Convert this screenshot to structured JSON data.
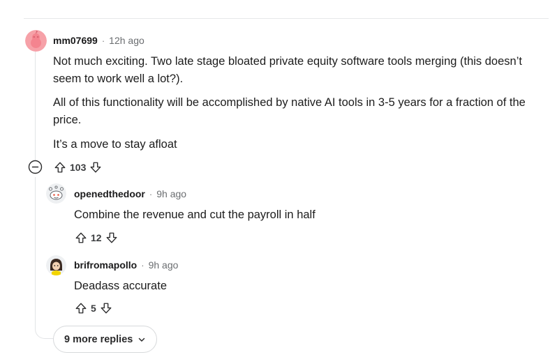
{
  "comment": {
    "username": "mm07699",
    "separator": "·",
    "time": "12h ago",
    "paragraphs": [
      "Not much exciting. Two late stage bloated private equity software tools merging (this doesn’t seem to work well a lot?).",
      "All of this functionality will be accomplished by native AI tools in 3-5 years for a fraction of the price.",
      "It’s a move to stay afloat"
    ],
    "votes": "103"
  },
  "replies": [
    {
      "username": "openedthedoor",
      "separator": "·",
      "time": "9h ago",
      "text": "Combine the revenue and cut the payroll in half",
      "votes": "12"
    },
    {
      "username": "brifromapollo",
      "separator": "·",
      "time": "9h ago",
      "text": "Deadass accurate",
      "votes": "5"
    }
  ],
  "more_replies": {
    "label": "9 more replies"
  },
  "icons": {
    "upvote": "arrow-up-outline-icon",
    "downvote": "arrow-down-outline-icon",
    "collapse": "minus-circle-icon",
    "more": "chevron-down-icon"
  },
  "colors": {
    "avatar_main": "#f6a1a8",
    "text": "#1c1c1c",
    "muted": "#6a6d70",
    "thread_line": "#e2e4e6"
  }
}
